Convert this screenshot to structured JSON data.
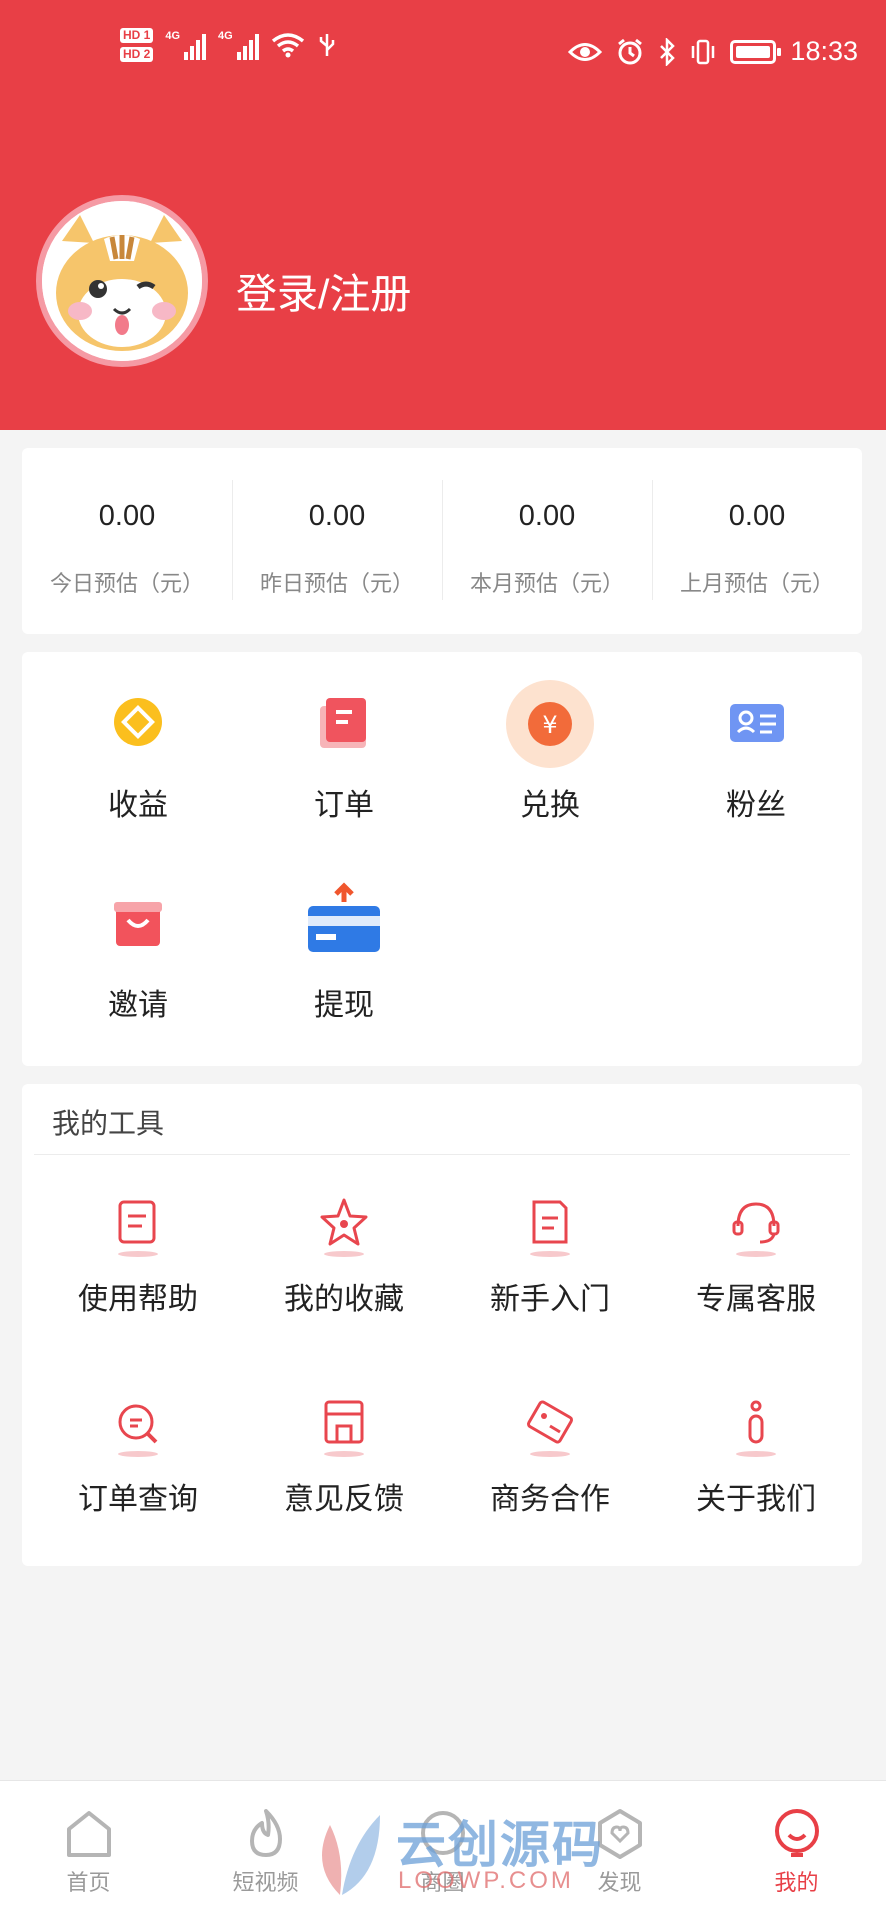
{
  "colors": {
    "brand": "#e83f46",
    "background": "#f4f4f4"
  },
  "status_bar": {
    "time": "18:33",
    "net1": "4G",
    "net2": "4G",
    "hd1": "HD 1",
    "hd2": "HD 2"
  },
  "profile": {
    "login_label": "登录/注册",
    "avatar_icon": "squirrel-avatar"
  },
  "stats": [
    {
      "value": "0.00",
      "label": "今日预估（元）"
    },
    {
      "value": "0.00",
      "label": "昨日预估（元）"
    },
    {
      "value": "0.00",
      "label": "本月预估（元）"
    },
    {
      "value": "0.00",
      "label": "上月预估（元）"
    }
  ],
  "functions": [
    {
      "label": "收益",
      "icon": "coin-icon"
    },
    {
      "label": "订单",
      "icon": "order-icon"
    },
    {
      "label": "兑换",
      "icon": "exchange-icon"
    },
    {
      "label": "粉丝",
      "icon": "fans-icon"
    },
    {
      "label": "邀请",
      "icon": "gift-icon"
    },
    {
      "label": "提现",
      "icon": "withdraw-icon"
    }
  ],
  "tools": {
    "title": "我的工具",
    "items": [
      {
        "label": "使用帮助",
        "icon": "help-doc-icon"
      },
      {
        "label": "我的收藏",
        "icon": "star-icon"
      },
      {
        "label": "新手入门",
        "icon": "guide-doc-icon"
      },
      {
        "label": "专属客服",
        "icon": "headset-icon"
      },
      {
        "label": "订单查询",
        "icon": "search-chat-icon"
      },
      {
        "label": "意见反馈",
        "icon": "store-icon"
      },
      {
        "label": "商务合作",
        "icon": "coupon-icon"
      },
      {
        "label": "关于我们",
        "icon": "info-icon"
      }
    ]
  },
  "tabbar": [
    {
      "label": "首页",
      "icon": "home-icon",
      "active": false
    },
    {
      "label": "短视频",
      "icon": "flame-icon",
      "active": false
    },
    {
      "label": "商圈",
      "icon": "shop-circle-icon",
      "active": false
    },
    {
      "label": "发现",
      "icon": "discover-icon",
      "active": false
    },
    {
      "label": "我的",
      "icon": "profile-icon",
      "active": true
    }
  ],
  "watermark": {
    "text": "云创源码",
    "sub": "LOOWP.COM"
  }
}
